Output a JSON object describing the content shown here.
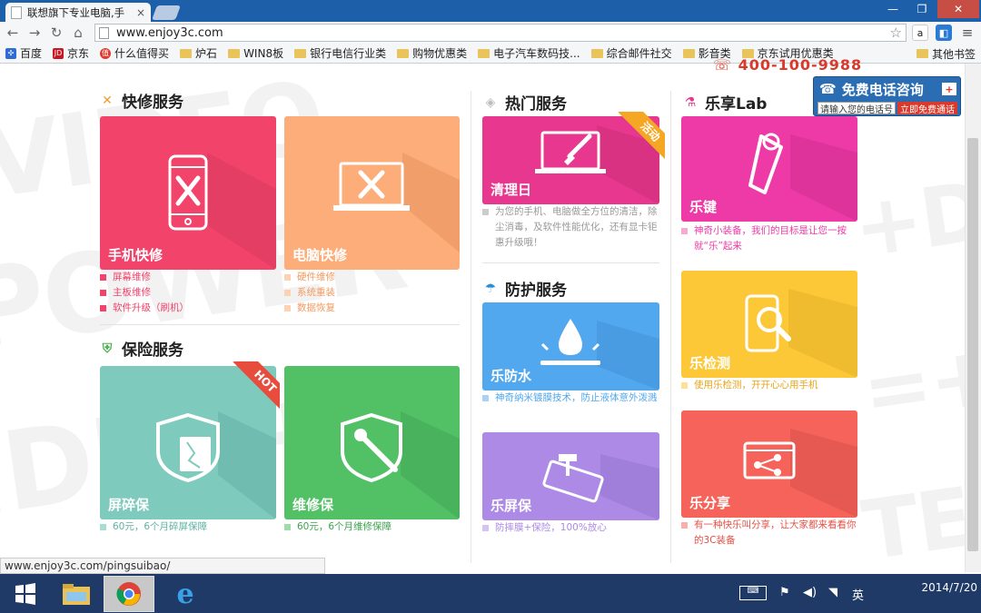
{
  "browser": {
    "tab_title": "联想旗下专业电脑,手",
    "url": "www.enjoy3c.com",
    "bookmarks": [
      "百度",
      "京东",
      "什么值得买",
      "炉石",
      "WIN8板",
      "银行电信行业类",
      "购物优惠类",
      "电子汽车数码技...",
      "综合邮件社交",
      "影音类",
      "京东试用优惠类"
    ],
    "bookmarks_other": "其他书签",
    "status_url": "www.enjoy3c.com/pingsuibao/"
  },
  "page": {
    "hotline": "400-100-9988",
    "call": {
      "title": "免费电话咨询",
      "placeholder": "请输入您的电话号",
      "button": "立即免费通话"
    },
    "sections": {
      "repair": "快修服务",
      "insurance": "保险服务",
      "hot": "热门服务",
      "protect": "防护服务",
      "lab": "乐享Lab"
    },
    "cards": {
      "phone": {
        "title": "手机快修",
        "items": [
          "屏幕维修",
          "主板维修",
          "软件升级（刷机）"
        ]
      },
      "pc": {
        "title": "电脑快修",
        "items": [
          "硬件维修",
          "系统重装",
          "数据恢复"
        ]
      },
      "screen": {
        "title": "屏碎保",
        "ribbon": "HOT",
        "items": [
          "60元，6个月碎屏保障"
        ]
      },
      "repairins": {
        "title": "维修保",
        "items": [
          "60元，6个月维修保障"
        ]
      },
      "clean": {
        "title": "清理日",
        "ribbon": "活动",
        "desc": "为您的手机、电脑做全方位的清洁，除尘消毒，及软件性能优化，还有显卡钜惠升级哦！"
      },
      "water": {
        "title": "乐防水",
        "desc": "神奇纳米镀膜技术，防止液体意外泼溅"
      },
      "film": {
        "title": "乐屏保",
        "desc": "防摔膜+保险，100%放心"
      },
      "key": {
        "title": "乐键",
        "desc": "神奇小装备，我们的目标是让您一按就“乐”起来"
      },
      "check": {
        "title": "乐检测",
        "desc": "使用乐检测，开开心心用手机"
      },
      "share": {
        "title": "乐分享",
        "desc": "有一种快乐叫分享，让大家都来看看你的3C装备"
      }
    }
  },
  "taskbar": {
    "time": "",
    "date": "2014/7/20",
    "ime": "英"
  }
}
